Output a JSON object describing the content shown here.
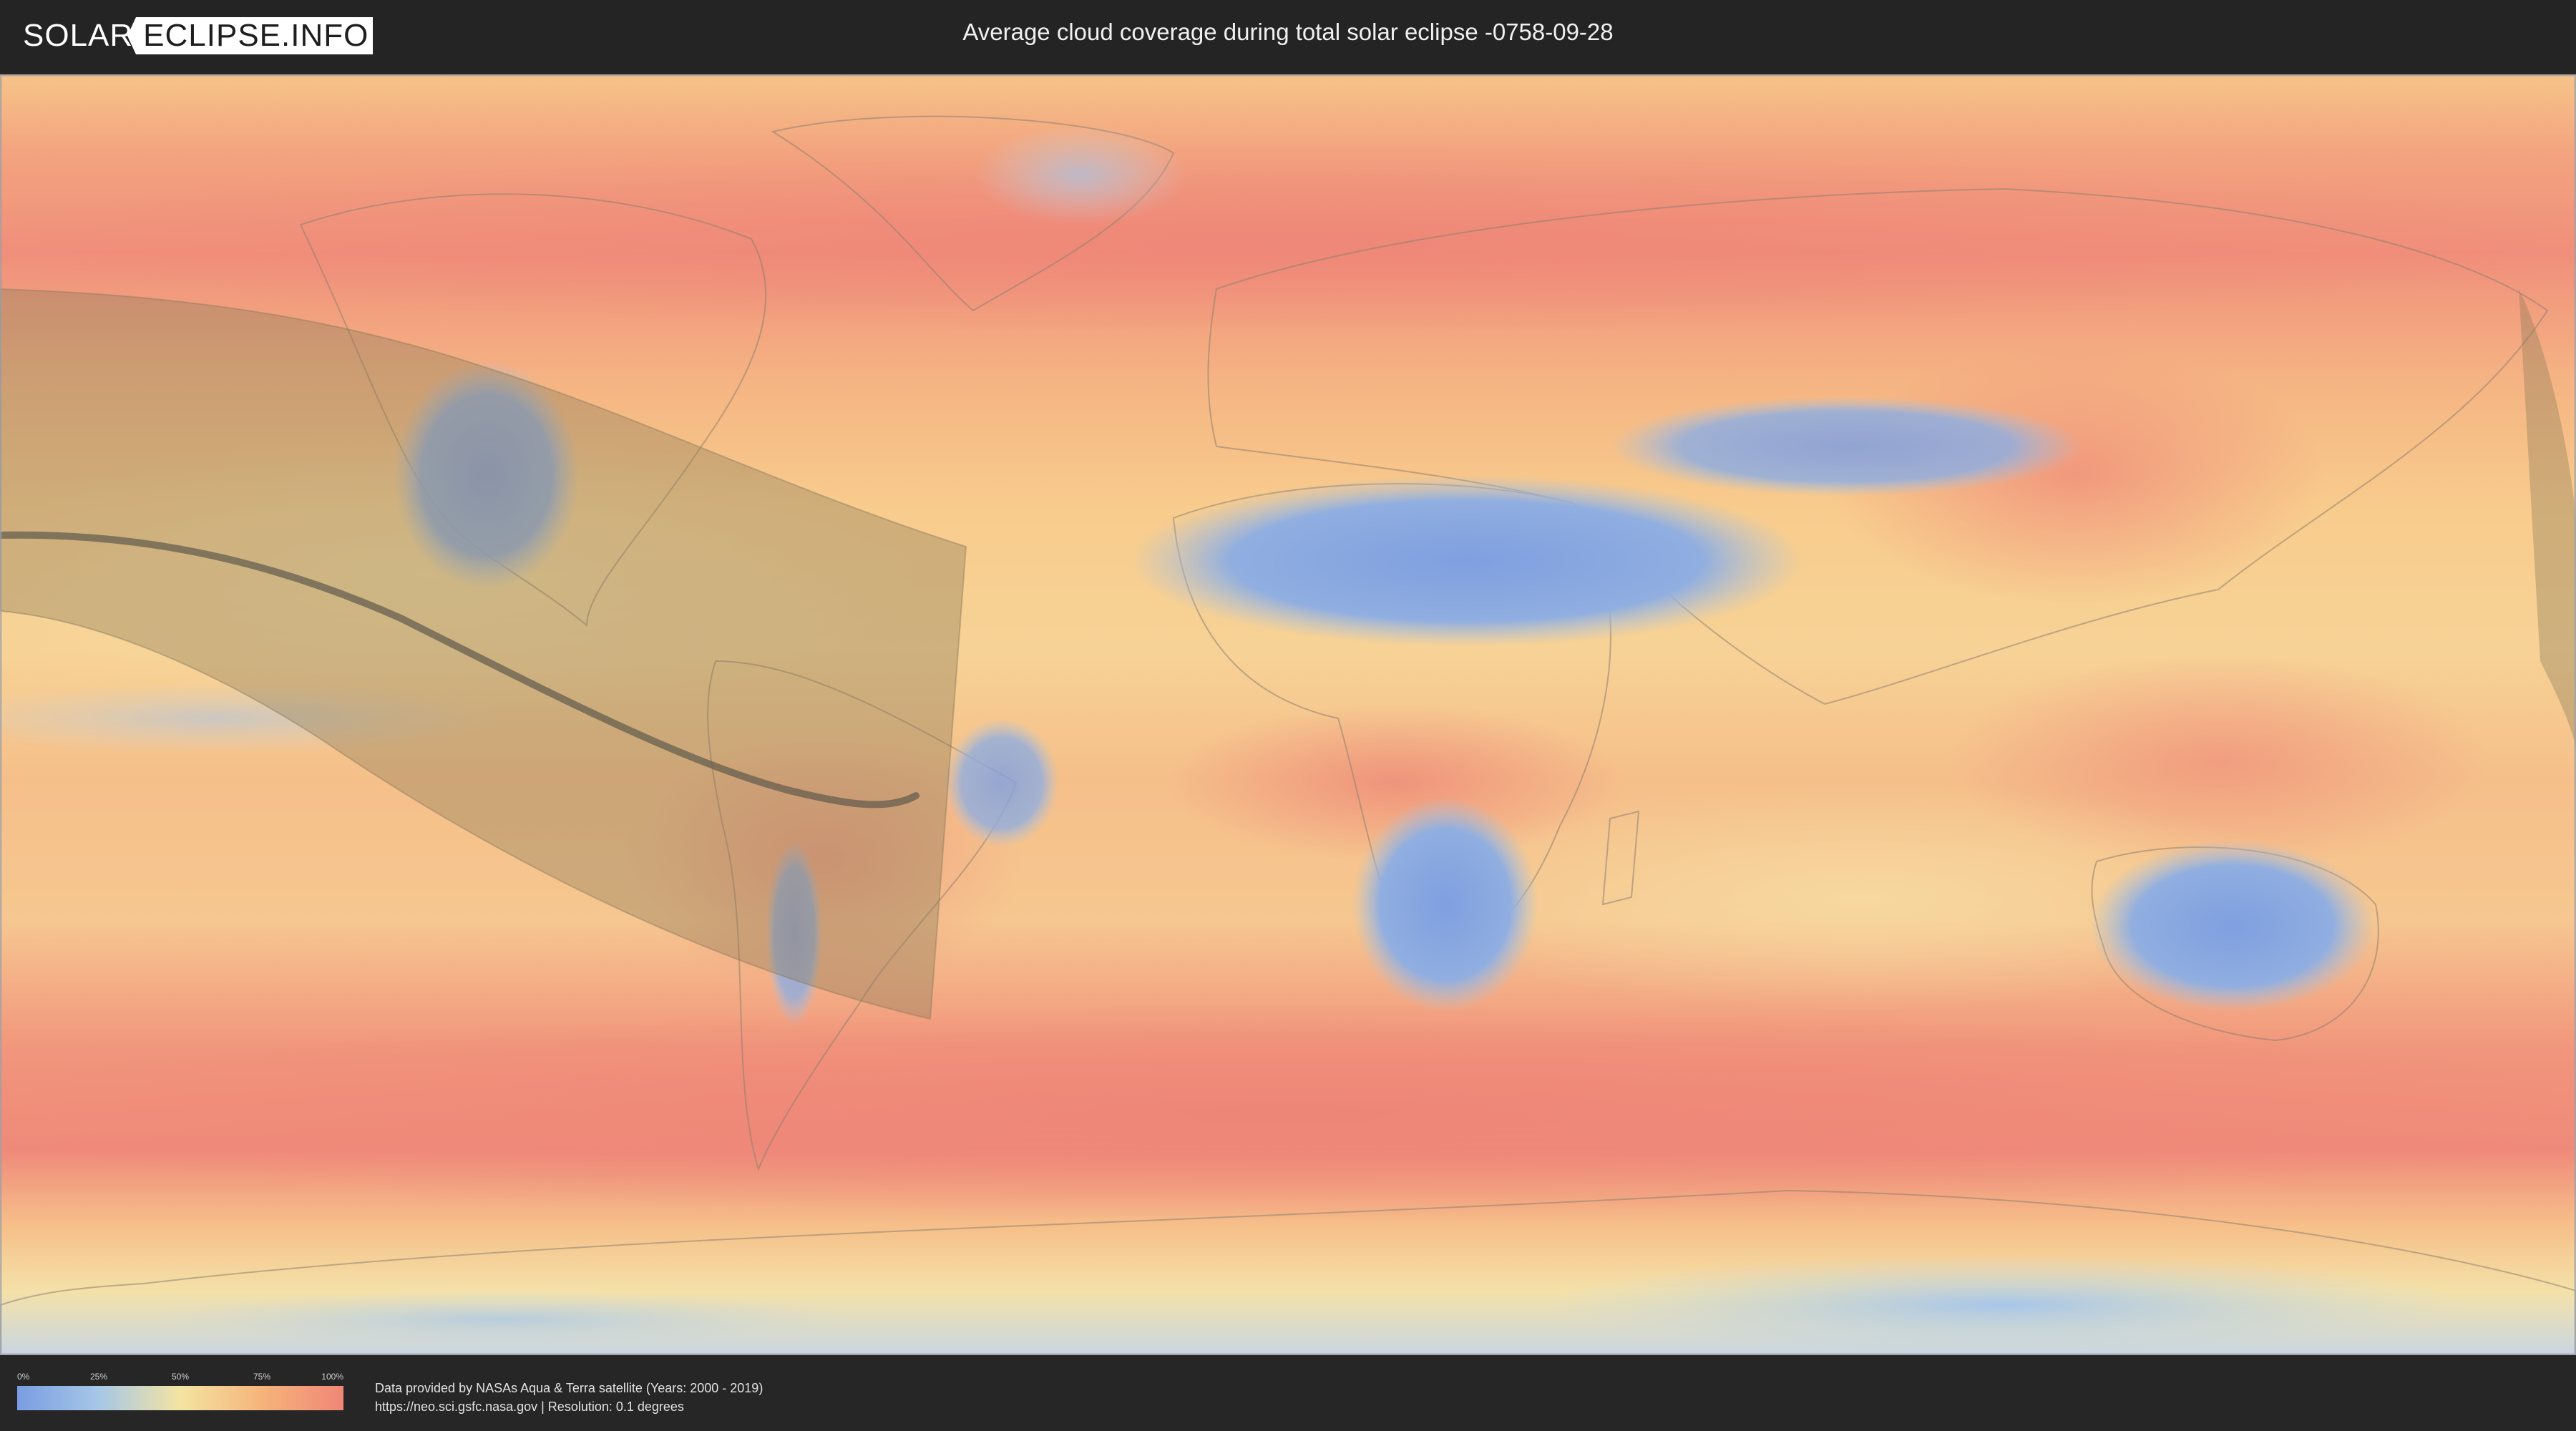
{
  "header": {
    "logo_left": "SOLAR",
    "logo_right": "ECLIPSE.INFO",
    "title": "Average cloud coverage during total solar eclipse -0758-09-28"
  },
  "map": {
    "layers": [
      "cloud-coverage",
      "eclipse-shadow-zone",
      "totality-path-line"
    ],
    "colors": {
      "low": "#7a9de2",
      "mid": "#f4e4a2",
      "high": "#f08677",
      "shadow_zone": "#8c7b5a",
      "totality_path": "#5f5a4c"
    }
  },
  "legend": {
    "ticks": [
      "0%",
      "25%",
      "50%",
      "75%",
      "100%"
    ]
  },
  "footer": {
    "credit_line1": "Data provided by NASAs Aqua & Terra satellite (Years: 2000 - 2019)",
    "credit_line2": "https://neo.sci.gsfc.nasa.gov | Resolution: 0.1 degrees"
  }
}
